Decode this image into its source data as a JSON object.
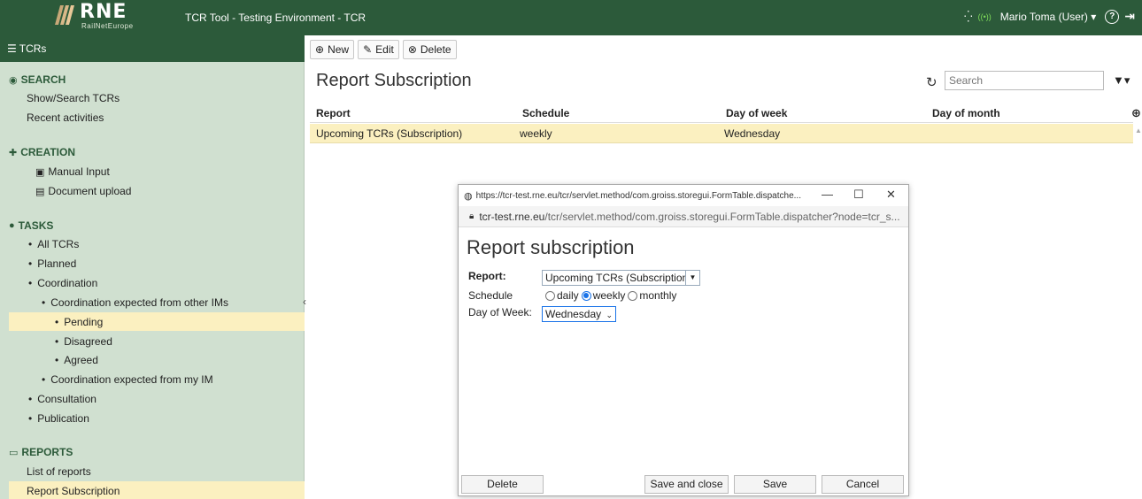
{
  "header": {
    "logo_text": "RNE",
    "logo_subtext": "RailNetEurope",
    "app_title": "TCR Tool - Testing Environment - TCR",
    "user": "Mario Toma (User)",
    "help_icon": "question-circle-icon",
    "logout_icon": "logout-icon"
  },
  "sidebar": {
    "title": "TCRs",
    "sections": {
      "search": {
        "title": "SEARCH",
        "items": [
          "Show/Search TCRs",
          "Recent activities"
        ]
      },
      "creation": {
        "title": "CREATION",
        "items": [
          "Manual Input",
          "Document upload"
        ]
      },
      "tasks": {
        "title": "TASKS",
        "items": [
          "All TCRs",
          "Planned",
          "Coordination",
          "Coordination expected from other IMs",
          "Pending",
          "Disagreed",
          "Agreed",
          "Coordination expected from my IM",
          "Consultation",
          "Publication"
        ]
      },
      "reports": {
        "title": "REPORTS",
        "items": [
          "List of reports",
          "Report Subscription"
        ]
      }
    },
    "active_item": "Pending"
  },
  "toolbar": {
    "new_label": "New",
    "edit_label": "Edit",
    "delete_label": "Delete"
  },
  "main": {
    "title": "Report Subscription",
    "search_placeholder": "Search",
    "table": {
      "columns": [
        "Report",
        "Schedule",
        "Day of week",
        "Day of month"
      ],
      "rows": [
        [
          "Upcoming TCRs (Subscription)",
          "weekly",
          "Wednesday",
          ""
        ]
      ]
    }
  },
  "popup": {
    "window_title": "https://tcr-test.rne.eu/tcr/servlet.method/com.groiss.storegui.FormTable.dispatche...",
    "url_host": "tcr-test.rne.eu",
    "url_path": "/tcr/servlet.method/com.groiss.storegui.FormTable.dispatcher?node=tcr_s...",
    "title": "Report subscription",
    "report_label": "Report:",
    "report_value": "Upcoming TCRs (Subscription)",
    "schedule_label": "Schedule",
    "schedule_options": [
      "daily",
      "weekly",
      "monthly"
    ],
    "schedule_selected": "weekly",
    "day_label": "Day of Week:",
    "day_value": "Wednesday",
    "buttons": {
      "delete": "Delete",
      "save_close": "Save and close",
      "save": "Save",
      "cancel": "Cancel"
    }
  },
  "colors": {
    "header_green": "#2c5a3a",
    "sidebar_bg": "#d0e0d0",
    "highlight": "#fbf0c0"
  }
}
